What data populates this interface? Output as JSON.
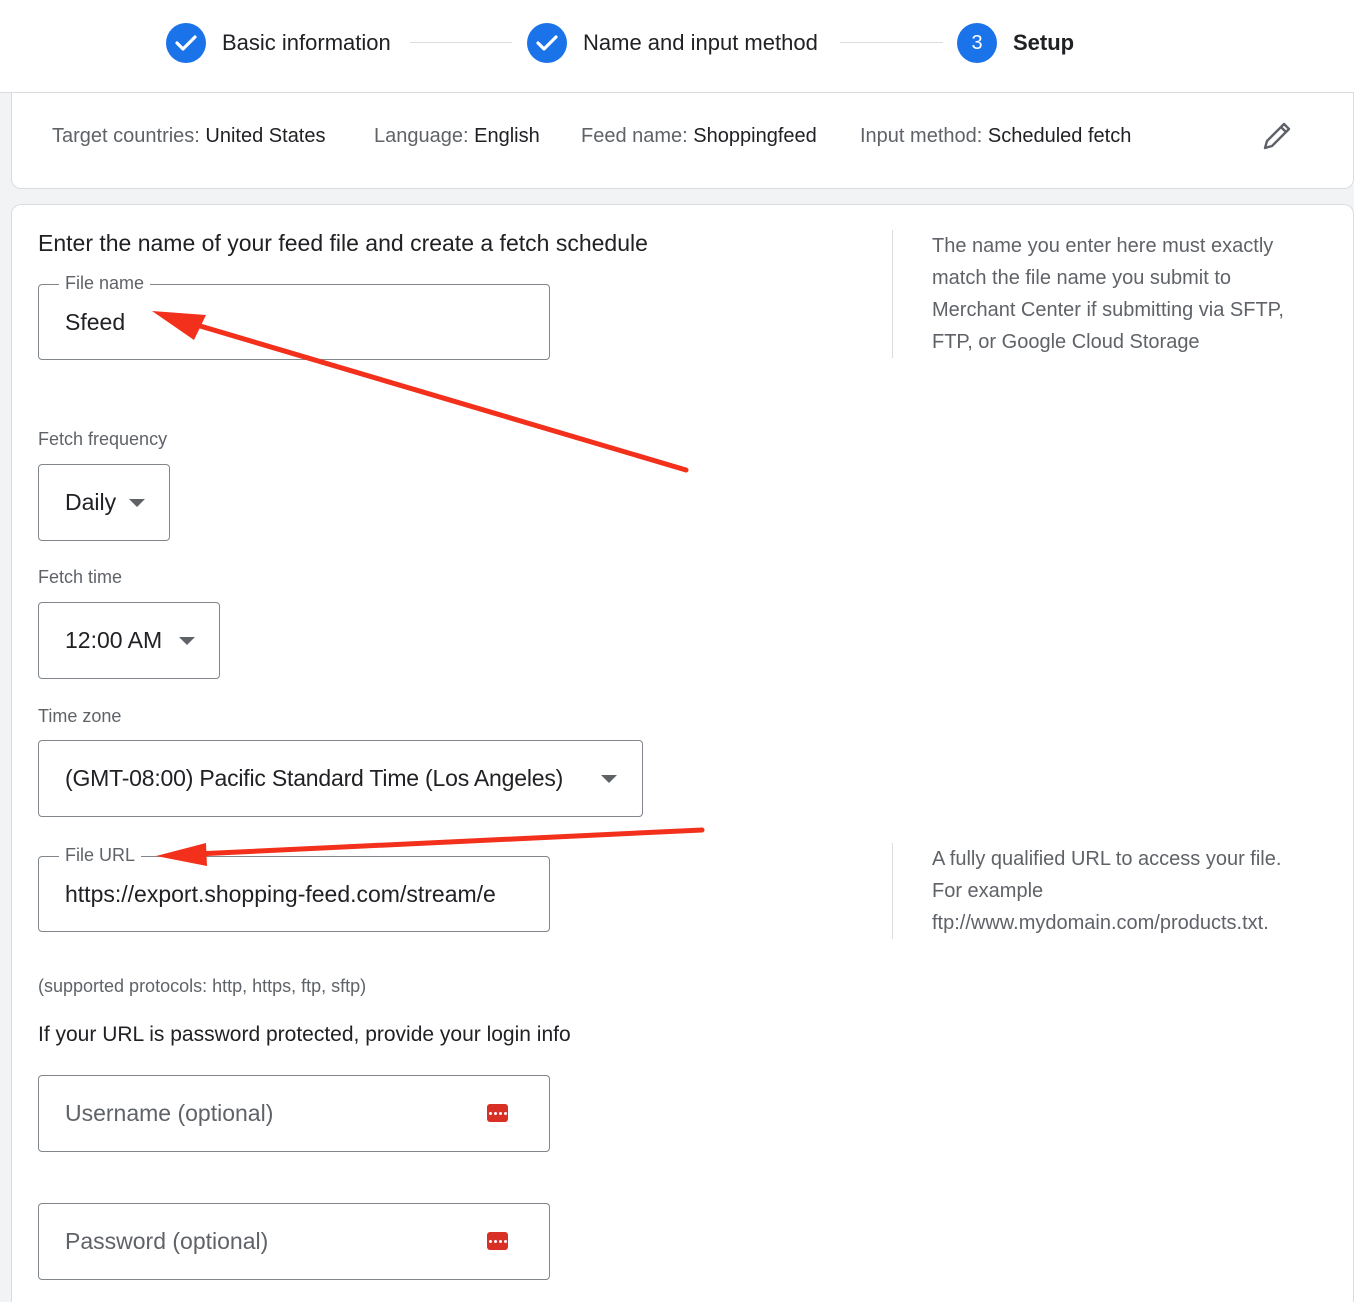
{
  "stepper": {
    "steps": [
      {
        "label": "Basic information",
        "state": "complete"
      },
      {
        "label": "Name and input method",
        "state": "complete"
      },
      {
        "label": "Setup",
        "number": "3",
        "state": "active"
      }
    ]
  },
  "summary": {
    "target_countries": {
      "label": "Target countries:",
      "value": "United States"
    },
    "language": {
      "label": "Language:",
      "value": "English"
    },
    "feed_name": {
      "label": "Feed name:",
      "value": "Shoppingfeed"
    },
    "input_method": {
      "label": "Input method:",
      "value": "Scheduled fetch"
    }
  },
  "form": {
    "heading": "Enter the name of your feed file and create a fetch schedule",
    "file_name": {
      "label": "File name",
      "value": "Sfeed"
    },
    "file_name_help": "The name you enter here must exactly match the file name you submit to Merchant Center if submitting via SFTP, FTP, or Google Cloud Storage",
    "fetch_frequency": {
      "label": "Fetch frequency",
      "value": "Daily"
    },
    "fetch_time": {
      "label": "Fetch time",
      "value": "12:00 AM"
    },
    "time_zone": {
      "label": "Time zone",
      "value": "(GMT-08:00) Pacific Standard Time (Los Angeles)"
    },
    "file_url": {
      "label": "File URL",
      "value": "https://export.shopping-feed.com/stream/e"
    },
    "file_url_help": "A fully qualified URL to access your file. For example ftp://www.mydomain.com/products.txt.",
    "protocols_note": "(supported protocols: http, https, ftp, sftp)",
    "login_heading": "If your URL is password protected, provide your login info",
    "username": {
      "placeholder": "Username (optional)"
    },
    "password": {
      "placeholder": "Password (optional)"
    }
  },
  "colors": {
    "accent": "#1a73e8",
    "annotation_arrow": "#f2301b",
    "key_icon": "#d93025"
  }
}
